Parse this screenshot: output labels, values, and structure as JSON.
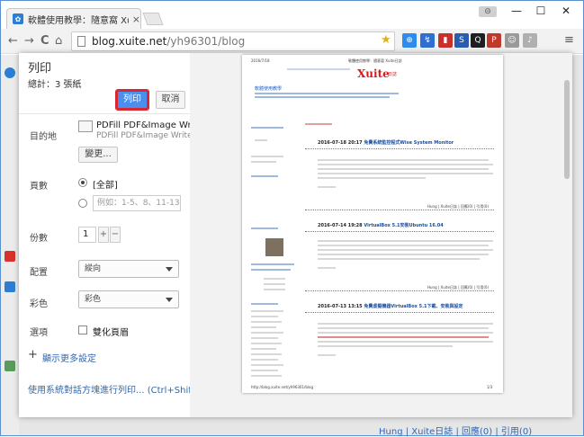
{
  "browser": {
    "tab_title": "軟體使用教學：隨意窩 Xu",
    "tab_close": "×",
    "user_badge": "⊝",
    "minimize": "—",
    "maximize": "☐",
    "close": "✕",
    "back": "←",
    "forward": "→",
    "reload": "C",
    "home": "⌂",
    "url_host": "blog.xuite.net",
    "url_path": "/yh96301/blog",
    "star": "★",
    "extensions": [
      {
        "name": "ext-1",
        "color": "#2d8cf0",
        "glyph": "⊕"
      },
      {
        "name": "ext-2",
        "color": "#2f6fd1",
        "glyph": "↯"
      },
      {
        "name": "ext-3",
        "color": "#c9302c",
        "glyph": "▮"
      },
      {
        "name": "ext-4",
        "color": "#2a5db0",
        "glyph": "S"
      },
      {
        "name": "ext-5",
        "color": "#1f1f1f",
        "glyph": "Q"
      },
      {
        "name": "ext-6",
        "color": "#c0392b",
        "glyph": "P"
      }
    ],
    "menu": "≡"
  },
  "background": {
    "footer_links": "Hung | Xuite日誌 | 回應(0) | 引用(0)"
  },
  "print": {
    "title": "列印",
    "total_label": "總計：3 張紙",
    "print_button": "列印",
    "cancel_button": "取消",
    "destination_label": "目的地",
    "printer_name": "PDFill PDF&Image Writer",
    "printer_sub": "PDFill PDF&Image Writer",
    "change_button": "變更...",
    "pages_label": "頁數",
    "pages_all": "[全部]",
    "pages_example_placeholder": "例如：1-5、8、11-13",
    "copies_label": "份數",
    "copies_value": "1",
    "copies_plus": "+",
    "copies_minus": "−",
    "layout_label": "配置",
    "layout_value": "縱向",
    "color_label": "彩色",
    "color_value": "彩色",
    "options_label": "選項",
    "two_sided": "雙化頁眉",
    "more_settings": "顯示更多設定",
    "more_plus": "+",
    "system_dialog": "使用系統對話方塊進行列印... (Ctrl+Shift+P)"
  },
  "preview": {
    "header_date": "2016/7/18",
    "header_title": "軟體使用教學：隨意窩 Xuite日誌",
    "logo": "Xuite",
    "logo_sub": "日誌",
    "blog_title": "軟體使用教學",
    "post1_date": "2016-07-18 20:17",
    "post1_title": "免費系統監控程式Wise System Monitor",
    "post2_date": "2016-07-14 19:28",
    "post2_title": "VirtualBox 5.1安裝Ubuntu 16.04",
    "post3_date": "2016-07-13 13:15",
    "post3_title": "免費虛擬機器VirtualBox 5.1下載、安裝與設定",
    "footer_url": "http://blog.xuite.net/yh96301/blog",
    "footer_page": "1/3",
    "byline": "Hung | Xuite日誌 | 回應(0) | 引用(0)"
  }
}
